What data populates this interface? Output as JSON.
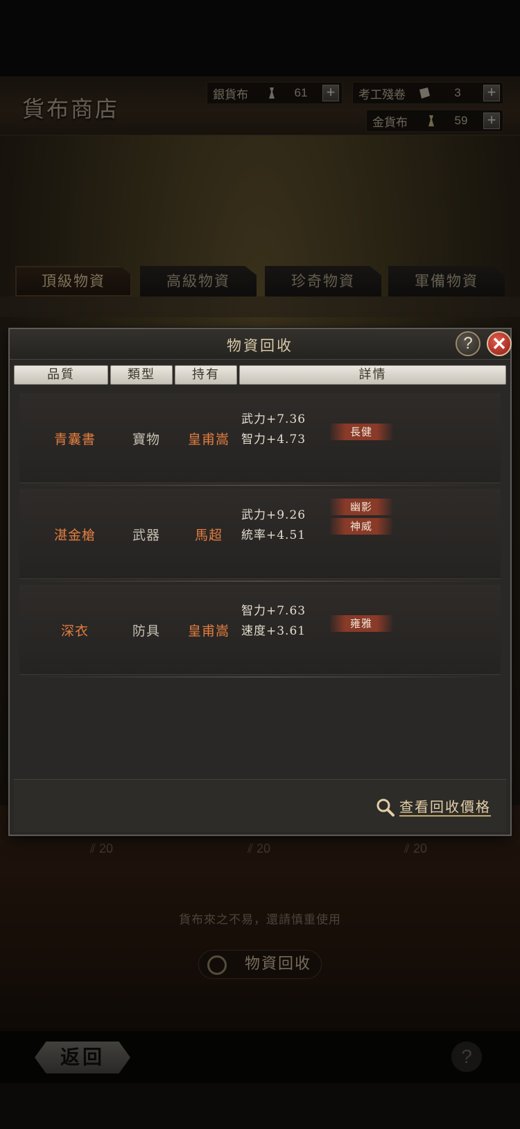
{
  "shop": {
    "title": "貨布商店",
    "currencies": [
      {
        "name": "銀貨布",
        "value": "61",
        "icon": "silver-coin-icon"
      },
      {
        "name": "考工殘卷",
        "value": "3",
        "icon": "scroll-icon"
      },
      {
        "name": "金貨布",
        "value": "59",
        "icon": "gold-coin-icon"
      }
    ],
    "plus_label": "+"
  },
  "tabs": [
    {
      "label": "頂級物資",
      "active": true
    },
    {
      "label": "高級物資",
      "active": false
    },
    {
      "label": "珍奇物資",
      "active": false
    },
    {
      "label": "軍備物資",
      "active": false
    }
  ],
  "prices": [
    "20",
    "20",
    "20"
  ],
  "footer_note": "貨布來之不易，還請慎重使用",
  "recycle_button_label": "物資回收",
  "back_label": "返回",
  "help_label": "?",
  "modal": {
    "title": "物資回收",
    "help_label": "?",
    "close_label": "✕",
    "columns": {
      "quality": "品質",
      "type": "類型",
      "owner": "持有",
      "details": "詳情"
    },
    "rows": [
      {
        "name": "青囊書",
        "type": "寶物",
        "owner": "皇甫嵩",
        "stats": [
          "武力+7.36",
          "智力+4.73"
        ],
        "tags": [
          "長健"
        ]
      },
      {
        "name": "湛金槍",
        "type": "武器",
        "owner": "馬超",
        "stats": [
          "武力+9.26",
          "統率+4.51"
        ],
        "tags": [
          "幽影",
          "神威"
        ]
      },
      {
        "name": "深衣",
        "type": "防具",
        "owner": "皇甫嵩",
        "stats": [
          "智力+7.63",
          "速度+3.61"
        ],
        "tags": [
          "雍雅"
        ]
      }
    ],
    "view_price_label": "查看回收價格"
  },
  "colors": {
    "item_name": "#e27d3f",
    "badge_bg": "#8a3a28",
    "close_red": "#c0392b",
    "link_gold": "#e3cfa6"
  }
}
